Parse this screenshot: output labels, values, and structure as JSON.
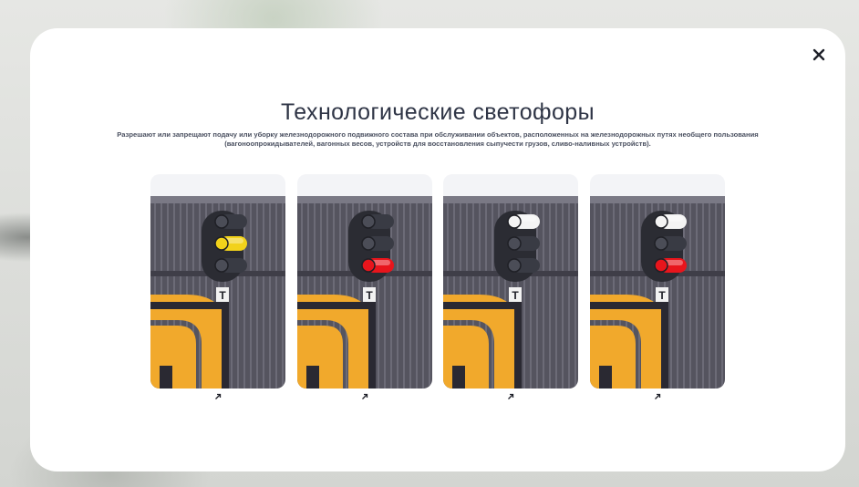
{
  "modal": {
    "title": "Технологические светофоры",
    "description": "Разрешают или запрещают подачу или уборку железнодорожного подвижного состава при обслуживании объектов, расположенных на железнодорожных путях необщего пользования (вагоноопрокидывателей, вагонных весов, устройств для восстановления сыпучести грузов, сливо-наливных устройств).",
    "close_icon": "close-icon"
  },
  "signals": [
    {
      "sign": "Т",
      "lit": [
        false,
        true,
        false
      ],
      "lit_colors": [
        "",
        "#f2d21a",
        ""
      ],
      "link_icon": "arrow-up-right-icon"
    },
    {
      "sign": "Т",
      "lit": [
        false,
        false,
        true
      ],
      "lit_colors": [
        "",
        "",
        "#e8151c"
      ],
      "link_icon": "arrow-up-right-icon"
    },
    {
      "sign": "Т",
      "lit": [
        true,
        false,
        false
      ],
      "lit_colors": [
        "#f4f4f4",
        "",
        ""
      ],
      "link_icon": "arrow-up-right-icon"
    },
    {
      "sign": "Т",
      "lit": [
        true,
        false,
        true
      ],
      "lit_colors": [
        "#f4f4f4",
        "",
        "#e8151c"
      ],
      "link_icon": "arrow-up-right-icon"
    }
  ],
  "colors": {
    "title": "#2f3546",
    "wall": "#55545f",
    "housing": "#2b2c33",
    "frame_yellow": "#f1a92c"
  }
}
